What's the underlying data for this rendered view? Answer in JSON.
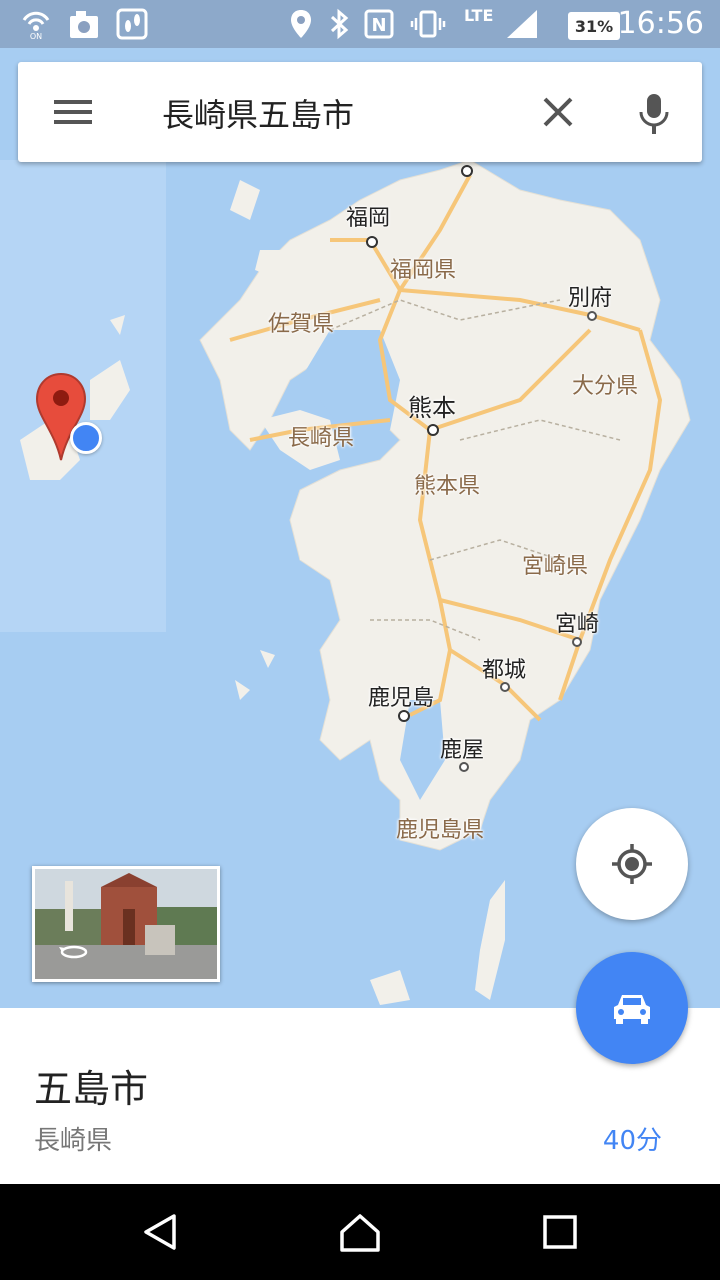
{
  "status_bar": {
    "time": "16:56",
    "battery": "31%",
    "network": "LTE",
    "icons": [
      "wifi-calling-icon",
      "camera-icon",
      "footsteps-icon",
      "location-icon",
      "bluetooth-icon",
      "nfc-icon",
      "vibrate-icon",
      "signal-icon"
    ]
  },
  "search": {
    "query": "長崎県五島市",
    "menu_icon": "menu-icon",
    "clear_icon": "close-icon",
    "voice_icon": "mic-icon"
  },
  "map": {
    "cities": [
      "福岡",
      "別府",
      "熊本",
      "宮崎",
      "都城",
      "鹿児島",
      "鹿屋"
    ],
    "prefectures": [
      "福岡県",
      "佐賀県",
      "長崎県",
      "大分県",
      "熊本県",
      "宮崎県",
      "鹿児島県"
    ],
    "pin_icon": "map-pin-icon",
    "my_location_icon": "current-location-dot-icon"
  },
  "streetview": {
    "icon": "360-rotate-icon"
  },
  "buttons": {
    "locate_icon": "my-location-icon",
    "drive_icon": "car-icon"
  },
  "place": {
    "title": "五島市",
    "subtitle": "長崎県",
    "drive_time": "40分"
  },
  "nav": {
    "back_icon": "back-icon",
    "home_icon": "home-icon",
    "recents_icon": "recents-icon"
  },
  "colors": {
    "water": "#a7cdf2",
    "land": "#f2f0ea",
    "road": "#f6c679",
    "pin": "#e74c3c",
    "accent": "#4285f4"
  }
}
